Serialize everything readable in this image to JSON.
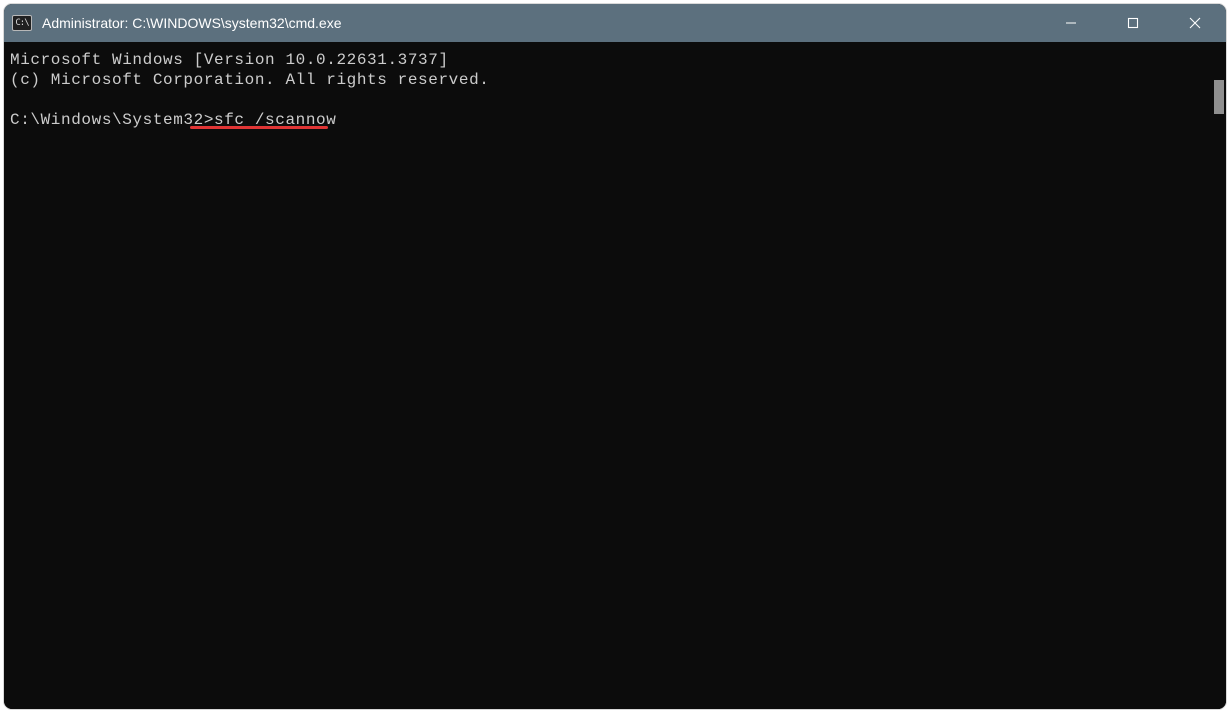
{
  "window": {
    "title": "Administrator: C:\\WINDOWS\\system32\\cmd.exe"
  },
  "terminal": {
    "line1": "Microsoft Windows [Version 10.0.22631.3737]",
    "line2": "(c) Microsoft Corporation. All rights reserved.",
    "blank": "",
    "prompt": "C:\\Windows\\System32>",
    "command": "sfc /scannow"
  },
  "annotation": {
    "underline_color": "#e03535"
  }
}
